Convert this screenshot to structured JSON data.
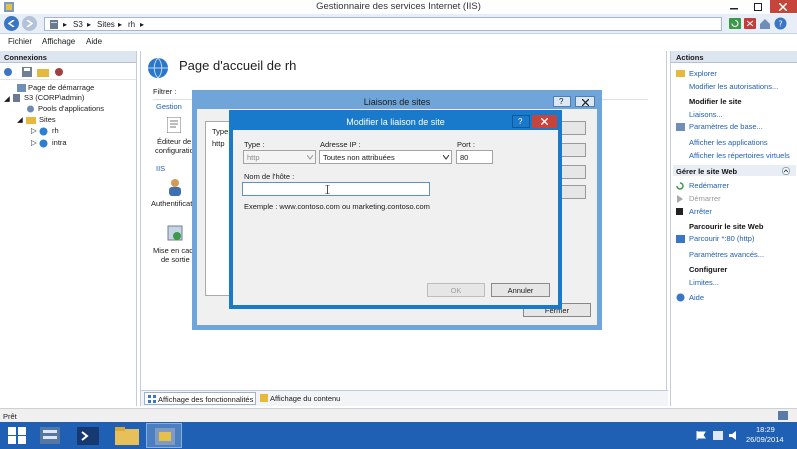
{
  "window": {
    "title": "Gestionnaire des services Internet (IIS)"
  },
  "breadcrumb": [
    "S3",
    "Sites",
    "rh"
  ],
  "menu": [
    "Fichier",
    "Affichage",
    "Aide"
  ],
  "connections": {
    "header": "Connexions",
    "tree": [
      {
        "label": "Page de démarrage",
        "icon": "home-icon"
      },
      {
        "label": "S3 (CORP\\admin)",
        "icon": "server-icon"
      },
      {
        "label": "Pools d'applications",
        "icon": "app-pools-icon"
      },
      {
        "label": "Sites",
        "icon": "folder-icon"
      },
      {
        "label": "rh",
        "icon": "globe-icon"
      },
      {
        "label": "intra",
        "icon": "globe-icon"
      }
    ]
  },
  "main": {
    "title": "Page d'accueil de rh",
    "filter_label": "Filtrer :",
    "group_gestion": "Gestion",
    "group_iis": "IIS",
    "feature_editor_lines": [
      "Éditeur de",
      "configuratio"
    ],
    "feature_auth": "Authentificati",
    "feature_cache_lines": [
      "Mise en cac",
      "de sortie"
    ],
    "tab_features": "Affichage des fonctionnalités",
    "tab_content": "Affichage du contenu"
  },
  "actions": {
    "header": "Actions",
    "items": [
      {
        "label": "Explorer",
        "kind": "link"
      },
      {
        "label": "Modifier les autorisations...",
        "kind": "link"
      },
      {
        "label": "Modifier le site",
        "kind": "heading"
      },
      {
        "label": "Liaisons...",
        "kind": "link"
      },
      {
        "label": "Paramètres de base...",
        "kind": "link"
      },
      {
        "label": "Afficher les applications",
        "kind": "link"
      },
      {
        "label": "Afficher les répertoires virtuels",
        "kind": "link"
      },
      {
        "label": "Gérer le site Web",
        "kind": "section"
      },
      {
        "label": "Redémarrer",
        "kind": "link"
      },
      {
        "label": "Démarrer",
        "kind": "disabled"
      },
      {
        "label": "Arrêter",
        "kind": "link"
      },
      {
        "label": "Parcourir le site Web",
        "kind": "heading"
      },
      {
        "label": "Parcourir *:80 (http)",
        "kind": "link"
      },
      {
        "label": "Paramètres avancés...",
        "kind": "link"
      },
      {
        "label": "Configurer",
        "kind": "heading"
      },
      {
        "label": "Limites...",
        "kind": "link"
      },
      {
        "label": "Aide",
        "kind": "link"
      }
    ]
  },
  "status": {
    "text": "Prêt"
  },
  "outer_dialog": {
    "title": "Liaisons de sites",
    "col_type": "Type",
    "row_type": "http",
    "close_label": "Fermer"
  },
  "binding_dialog": {
    "title": "Modifier la liaison de site",
    "type_label": "Type :",
    "type_value": "http",
    "ip_label": "Adresse IP :",
    "ip_value": "Toutes non attribuées",
    "port_label": "Port :",
    "port_value": "80",
    "host_label": "Nom de l'hôte :",
    "host_value": "",
    "example": "Exemple : www.contoso.com ou marketing.contoso.com",
    "ok_label": "OK",
    "cancel_label": "Annuler"
  },
  "taskbar": {
    "time": "18:29",
    "date": "26/09/2014"
  },
  "colors": {
    "accent": "#1979ca",
    "taskbar": "#1f5fb4",
    "link": "#1f5fb4"
  }
}
